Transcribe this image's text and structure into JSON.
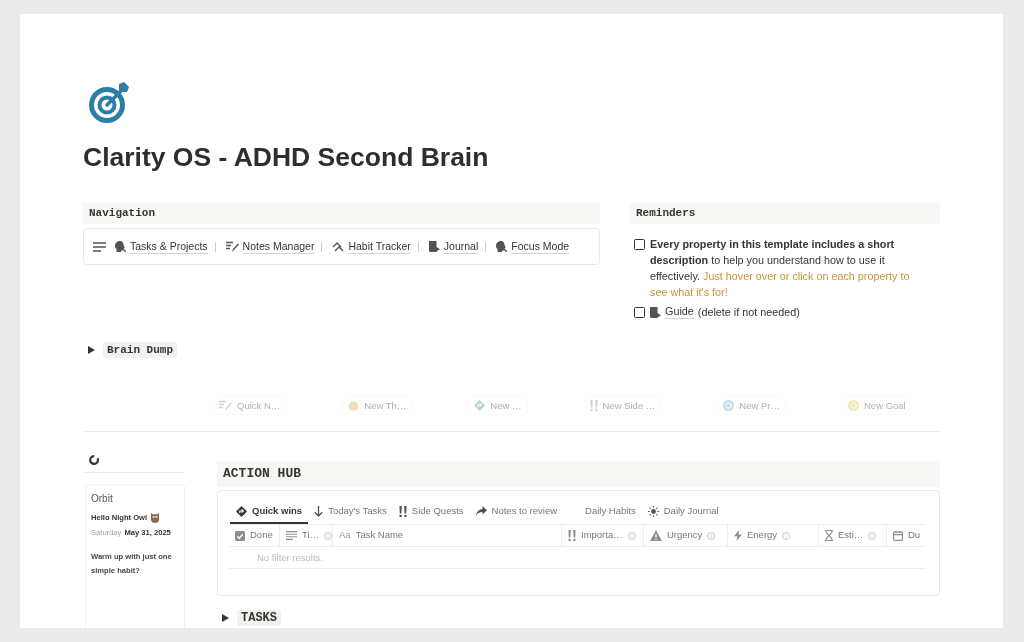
{
  "page": {
    "title": "Clarity OS - ADHD Second Brain"
  },
  "navigation": {
    "heading": "Navigation",
    "links": [
      {
        "label": "Tasks & Projects"
      },
      {
        "label": "Notes Manager"
      },
      {
        "label": "Habit Tracker"
      },
      {
        "label": "Journal"
      },
      {
        "label": "Focus Mode"
      }
    ]
  },
  "reminders": {
    "heading": "Reminders",
    "items": [
      {
        "kind": "note",
        "checked": false,
        "text": "**Every property in this template includes a short description** to help you understand how to use it effectively.",
        "highlight": "Just hover over or click on each property to see what it's for!"
      },
      {
        "kind": "link",
        "checked": false,
        "link": "Guide",
        "text": "(delete if not needed)"
      }
    ]
  },
  "brain_dump": {
    "label": "Brain Dump",
    "expanded": false
  },
  "quick_buttons": [
    {
      "label": "Quick N…"
    },
    {
      "label": "New Th…"
    },
    {
      "label": "New …"
    },
    {
      "label": "New Side …"
    },
    {
      "label": "New Pr…"
    },
    {
      "label": "New Goal"
    }
  ],
  "sidebar": {
    "widget": {
      "title": "Orbit",
      "greeting": "Hello Night Owl",
      "weekday": "Saturday",
      "date": "May 31, 2025",
      "prompt": "Warm up with just one simple habit?"
    }
  },
  "action_hub": {
    "heading": "ACTION HUB",
    "tabs": [
      {
        "label": "Quick wins",
        "selected": true
      },
      {
        "label": "Today's Tasks",
        "selected": false
      },
      {
        "label": "Side Quests",
        "selected": false
      },
      {
        "label": "Notes to review",
        "selected": false
      },
      {
        "label": "Daily Habits",
        "selected": false
      },
      {
        "label": "Daily Journal",
        "selected": false
      }
    ],
    "table": {
      "columns": [
        {
          "label": "Done",
          "info": false
        },
        {
          "label": "Ti…",
          "info": true
        },
        {
          "label": "Task Name",
          "glyph": "Aa",
          "info": false
        },
        {
          "label": "Importa…",
          "info": true
        },
        {
          "label": "Urgency",
          "info": true
        },
        {
          "label": "Energy",
          "info": true
        },
        {
          "label": "Esti…",
          "info": true
        },
        {
          "label": "Du",
          "info": false
        }
      ],
      "empty_text": "No filter results."
    }
  },
  "tasks": {
    "label": "TASKS",
    "expanded": false
  }
}
